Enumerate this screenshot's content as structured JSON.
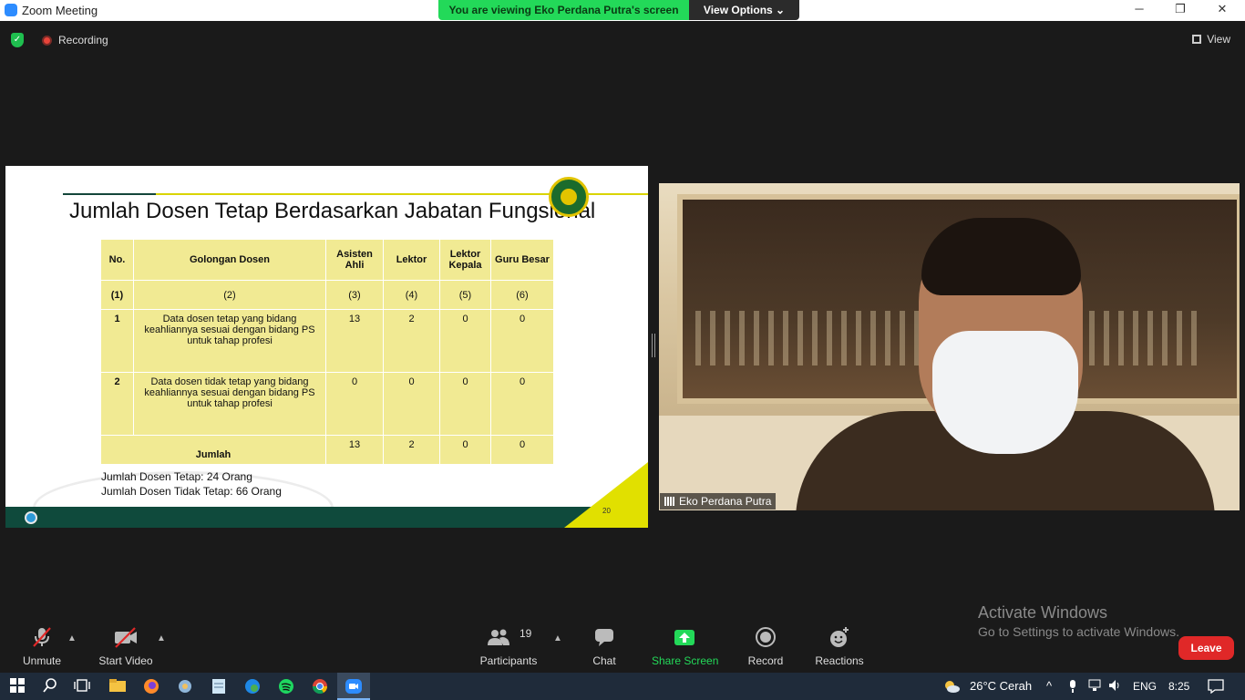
{
  "window": {
    "title": "Zoom Meeting",
    "minimize": "─",
    "restore": "❐",
    "close": "✕"
  },
  "banner": {
    "viewing": "You are viewing Eko Perdana Putra's screen",
    "view_options": "View Options ⌄"
  },
  "topbar": {
    "recording": "Recording",
    "view": "View"
  },
  "slide": {
    "title": "Jumlah Dosen Tetap Berdasarkan Jabatan Fungsional",
    "headers": [
      "No.",
      "Golongan Dosen",
      "Asisten Ahli",
      "Lektor",
      "Lektor Kepala",
      "Guru Besar"
    ],
    "column_numbers": [
      "(1)",
      "(2)",
      "(3)",
      "(4)",
      "(5)",
      "(6)"
    ],
    "rows": [
      {
        "no": "1",
        "golongan": "Data dosen tetap yang bidang keahliannya sesuai dengan bidang PS untuk tahap profesi",
        "asisten_ahli": "13",
        "lektor": "2",
        "lektor_kepala": "0",
        "guru_besar": "0"
      },
      {
        "no": "2",
        "golongan": "Data dosen tidak tetap yang bidang keahliannya sesuai dengan bidang PS untuk tahap profesi",
        "asisten_ahli": "0",
        "lektor": "0",
        "lektor_kepala": "0",
        "guru_besar": "0"
      }
    ],
    "total": {
      "label": "Jumlah",
      "asisten_ahli": "13",
      "lektor": "2",
      "lektor_kepala": "0",
      "guru_besar": "0"
    },
    "note_tetap": "Jumlah Dosen Tetap: 24 Orang",
    "note_tidak_tetap": "Jumlah Dosen Tidak Tetap: 66 Orang",
    "page_number": "20"
  },
  "video": {
    "participant_name": "Eko Perdana Putra"
  },
  "watermark": {
    "title": "Activate Windows",
    "subtitle": "Go to Settings to activate Windows."
  },
  "toolbar": {
    "unmute": "Unmute",
    "start_video": "Start Video",
    "participants": "Participants",
    "participants_count": "19",
    "chat": "Chat",
    "share_screen": "Share Screen",
    "record": "Record",
    "reactions": "Reactions",
    "leave": "Leave"
  },
  "taskbar": {
    "weather": "26°C  Cerah",
    "language": "ENG",
    "time": "8:25"
  },
  "colors": {
    "share_green": "#23d959",
    "leave_red": "#e02828",
    "table_yellow": "#f1ea93",
    "slide_green": "#0f4a3c"
  }
}
